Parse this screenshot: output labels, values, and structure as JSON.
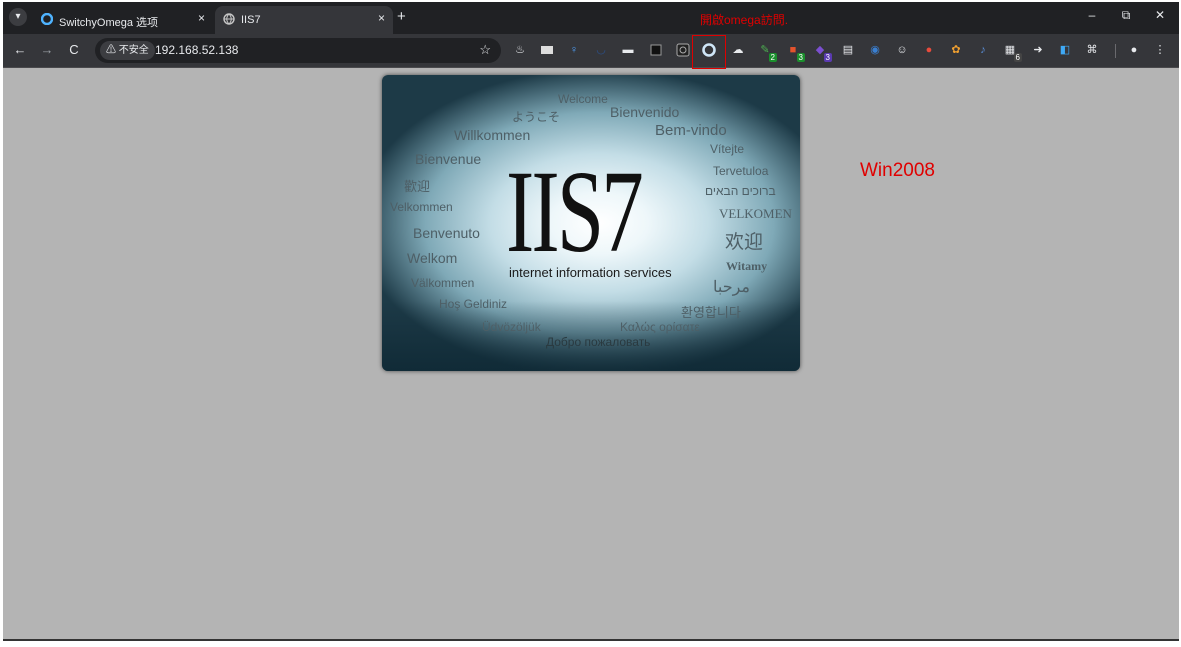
{
  "browser": {
    "tabs": [
      {
        "title": "SwitchyOmega 选项"
      },
      {
        "title": "IIS7"
      }
    ],
    "tab_close_glyph": "×",
    "new_tab_glyph": "+",
    "window_controls": {
      "minimize": "–",
      "restore": "⧉",
      "close": "✕"
    },
    "nav": {
      "back": "←",
      "forward": "→",
      "reload": "C"
    },
    "security_chip": "⚠ 不安全",
    "url": "192.168.52.138",
    "bookmark_glyph": "☆",
    "extension_badges": {
      "ext1": "2",
      "ext2": "3",
      "ext3": "3",
      "ext4": "6"
    },
    "profile_glyph": "●",
    "menu_glyph": "⋮"
  },
  "annotation": {
    "callout_text": "開啟omega訪問.",
    "side_label": "Win2008",
    "highlight_color": "#e00000"
  },
  "iis_banner": {
    "title": "IIS7",
    "subtitle": "internet information services",
    "welcome_words": [
      "Welcome",
      "ようこそ",
      "Bienvenido",
      "Willkommen",
      "Bem-vindo",
      "Vítejte",
      "Bienvenue",
      "Tervetuloa",
      "歡迎",
      "ברוכים הבאים",
      "Velkommen",
      "VELKOMEN",
      "Benvenuto",
      "欢迎",
      "Welkom",
      "Witamy",
      "Välkommen",
      "مرحبا",
      "Hoş Geldiniz",
      "환영합니다",
      "Üdvözöljük",
      "Καλώς ορίσατε",
      "Добро пожаловать"
    ]
  }
}
